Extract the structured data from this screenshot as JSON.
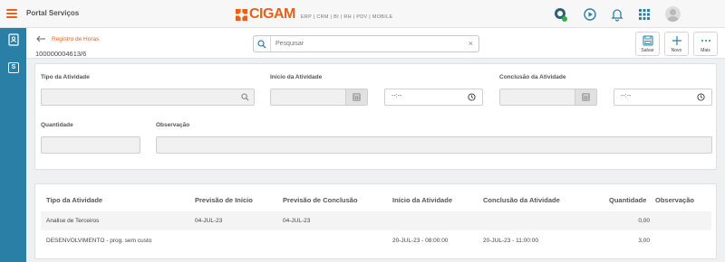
{
  "topbar": {
    "portal_title": "Portal Serviços",
    "brand_name": "CIGAM",
    "brand_modules": "ERP | CRM | BI | RH | PDV | MOBILE",
    "brand_color": "#e8611a",
    "icons": [
      "support-icon",
      "play-icon",
      "bell-icon",
      "apps-grid-icon",
      "user-avatar-icon"
    ]
  },
  "sidebar": {
    "color": "#2a7fa6",
    "items": [
      {
        "icon": "contacts-book-icon"
      },
      {
        "icon": "s-badge-icon",
        "label": "S"
      }
    ]
  },
  "header": {
    "breadcrumb": "Registro de Horas",
    "record_id": "100000004613/6",
    "search": {
      "placeholder": "Pesquisar",
      "value": ""
    },
    "actions": [
      {
        "label": "Salvar",
        "icon": "save-icon"
      },
      {
        "label": "Novo",
        "icon": "plus-icon"
      },
      {
        "label": "Mais",
        "icon": "more-dots-icon"
      }
    ]
  },
  "form": {
    "tipo_atividade": {
      "label": "Tipo da Atividade",
      "value": ""
    },
    "inicio": {
      "label": "Início da Atividade",
      "date": "",
      "time": "--:--"
    },
    "conclusao": {
      "label": "Conclusão da Atividade",
      "date": "",
      "time": "--:--"
    },
    "quantidade": {
      "label": "Quantidade",
      "value": ""
    },
    "observacao": {
      "label": "Observação",
      "value": ""
    }
  },
  "table": {
    "columns": [
      "Tipo da Atividade",
      "Previsão de Início",
      "Previsão de Conclusão",
      "Início da Atividade",
      "Conclusão da Atividade",
      "Quantidade",
      "Observação"
    ],
    "rows": [
      {
        "tipo": "Analise de Terceiros",
        "prev_inicio": "04-JUL-23",
        "prev_conclusao": "04-JUL-23",
        "inicio": "",
        "conclusao": "",
        "quantidade": "0,00",
        "observacao": ""
      },
      {
        "tipo": "DESENVOLVIMENTO - prog. sem custo",
        "prev_inicio": "",
        "prev_conclusao": "",
        "inicio": "20-JUL-23 - 08:00:00",
        "conclusao": "20-JUL-23 - 11:00:00",
        "quantidade": "3,00",
        "observacao": ""
      }
    ]
  }
}
